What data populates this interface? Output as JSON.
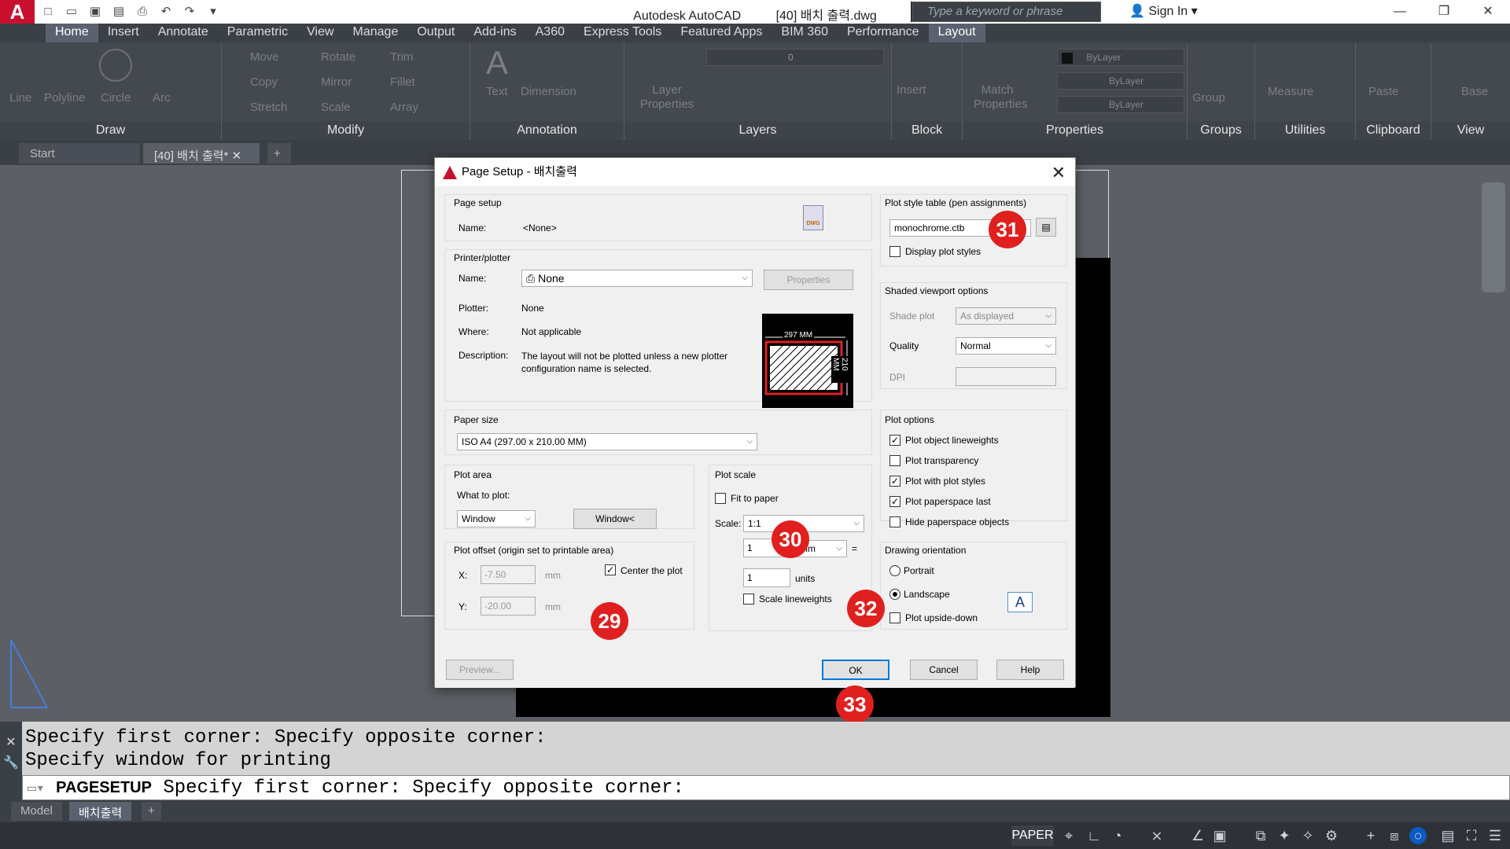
{
  "app": {
    "title": "Autodesk AutoCAD",
    "file": "[40] 배치 출력.dwg",
    "search_placeholder": "Type a keyword or phrase",
    "sign_in": "Sign In",
    "logo": "A"
  },
  "ribbon_tabs": [
    "Home",
    "Insert",
    "Annotate",
    "Parametric",
    "View",
    "Manage",
    "Output",
    "Add-ins",
    "A360",
    "Express Tools",
    "Featured Apps",
    "BIM 360",
    "Performance",
    "Layout"
  ],
  "ribbon_active": "Layout",
  "ribbon": {
    "draw": {
      "title": "Draw",
      "line": "Line",
      "polyline": "Polyline",
      "circle": "Circle",
      "arc": "Arc"
    },
    "modify": {
      "title": "Modify",
      "move": "Move",
      "rotate": "Rotate",
      "trim": "Trim",
      "copy": "Copy",
      "mirror": "Mirror",
      "fillet": "Fillet",
      "stretch": "Stretch",
      "scale": "Scale",
      "array": "Array"
    },
    "annotation": {
      "title": "Annotation",
      "text": "Text",
      "dimension": "Dimension"
    },
    "layers": {
      "title": "Layers",
      "layer_properties": "Layer Properties",
      "current_layer": "0"
    },
    "block": {
      "title": "Block",
      "insert": "Insert"
    },
    "properties": {
      "title": "Properties",
      "match": "Match Properties",
      "color": "ByLayer",
      "linetype": "ByLayer",
      "lineweight": "ByLayer"
    },
    "groups": {
      "title": "Groups",
      "group": "Group"
    },
    "utilities": {
      "title": "Utilities",
      "measure": "Measure"
    },
    "clipboard": {
      "title": "Clipboard",
      "paste": "Paste"
    },
    "view": {
      "title": "View",
      "base": "Base"
    }
  },
  "doc_tabs": {
    "start": "Start",
    "current": "[40] 배치 출력*"
  },
  "dialog": {
    "title": "Page Setup - 배치출력",
    "page_setup": {
      "heading": "Page setup",
      "name_label": "Name:",
      "name_value": "<None>"
    },
    "printer": {
      "heading": "Printer/plotter",
      "name_label": "Name:",
      "name_value": "None",
      "properties_btn": "Properties",
      "plotter_label": "Plotter:",
      "plotter_value": "None",
      "where_label": "Where:",
      "where_value": "Not applicable",
      "desc_label": "Description:",
      "desc_value": "The layout will not be plotted unless a new plotter configuration name is selected.",
      "preview_w": "297 MM",
      "preview_h": "210 MM"
    },
    "paper_size": {
      "heading": "Paper size",
      "value": "ISO A4 (297.00 x 210.00 MM)"
    },
    "plot_area": {
      "heading": "Plot area",
      "what_label": "What to plot:",
      "what_value": "Window",
      "window_btn": "Window<"
    },
    "plot_offset": {
      "heading": "Plot offset (origin set to printable area)",
      "x_label": "X:",
      "x_value": "-7.50",
      "y_label": "Y:",
      "y_value": "-20.00",
      "unit": "mm",
      "center_label": "Center the plot",
      "center_checked": true
    },
    "plot_scale": {
      "heading": "Plot scale",
      "fit_label": "Fit to paper",
      "fit_checked": false,
      "scale_label": "Scale:",
      "scale_value": "1:1",
      "num1": "1",
      "unit_select": "mm",
      "equals": "=",
      "num2": "1",
      "units_label": "units",
      "lineweights_label": "Scale lineweights",
      "lineweights_checked": false
    },
    "plot_style": {
      "heading": "Plot style table (pen assignments)",
      "value": "monochrome.ctb",
      "display_label": "Display plot styles",
      "display_checked": false
    },
    "shaded": {
      "heading": "Shaded viewport options",
      "shade_label": "Shade plot",
      "shade_value": "As displayed",
      "quality_label": "Quality",
      "quality_value": "Normal",
      "dpi_label": "DPI",
      "dpi_value": ""
    },
    "plot_options": {
      "heading": "Plot options",
      "items": [
        {
          "label": "Plot object lineweights",
          "checked": true
        },
        {
          "label": "Plot transparency",
          "checked": false
        },
        {
          "label": "Plot with plot styles",
          "checked": true
        },
        {
          "label": "Plot paperspace last",
          "checked": true
        },
        {
          "label": "Hide paperspace objects",
          "checked": false
        }
      ]
    },
    "orientation": {
      "heading": "Drawing orientation",
      "portrait": "Portrait",
      "landscape": "Landscape",
      "upside_down": "Plot upside-down",
      "selected": "Landscape",
      "upside_checked": false,
      "icon_letter": "A"
    },
    "buttons": {
      "preview": "Preview...",
      "ok": "OK",
      "cancel": "Cancel",
      "help": "Help"
    }
  },
  "annotations": [
    "29",
    "30",
    "31",
    "32",
    "33"
  ],
  "command": {
    "line1": "Specify first corner: Specify opposite corner:",
    "line2": "Specify window for printing",
    "prompt_cmd": "PAGESETUP",
    "prompt_text": "Specify first corner: Specify opposite corner:"
  },
  "layout_tabs": {
    "model": "Model",
    "layout": "배치출력"
  },
  "status": {
    "space": "PAPER"
  },
  "colors": {
    "accent": "#0078d7",
    "badge": "#e0201f",
    "brand": "#c8102e",
    "ribbon_bg": "#44484f"
  }
}
